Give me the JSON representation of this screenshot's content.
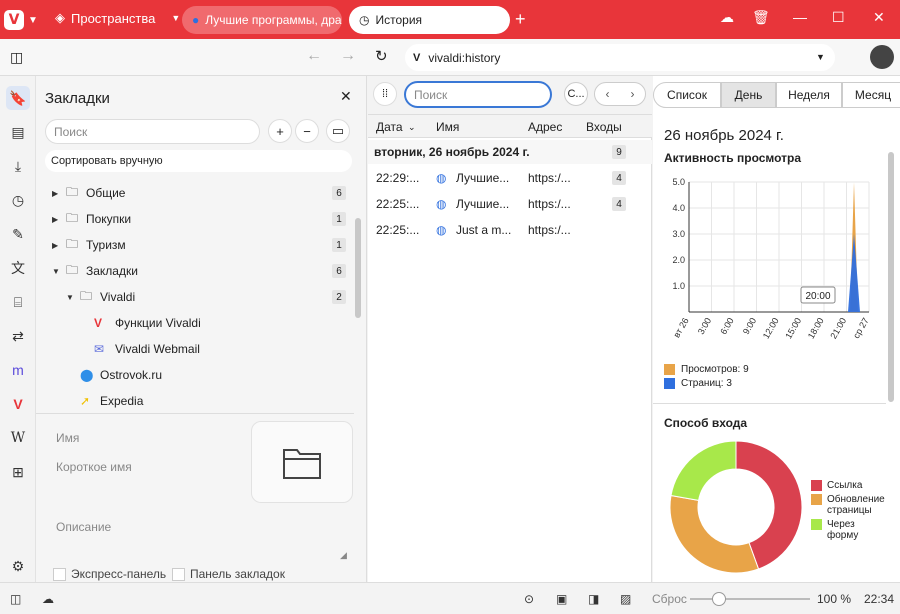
{
  "titlebar": {
    "spaces_label": "Пространства",
    "tabs": [
      {
        "title": "Лучшие программы, драй"
      },
      {
        "title": "История"
      }
    ]
  },
  "addressbar": {
    "url": "vivaldi:history"
  },
  "bookmarks": {
    "title": "Закладки",
    "search_placeholder": "Поиск",
    "sort_label": "Сортировать вручную",
    "items": [
      {
        "label": "Общие",
        "count": "6"
      },
      {
        "label": "Покупки",
        "count": "1"
      },
      {
        "label": "Туризм",
        "count": "1"
      },
      {
        "label": "Закладки",
        "count": "6"
      },
      {
        "label": "Vivaldi",
        "count": "2"
      },
      {
        "label": "Функции Vivaldi"
      },
      {
        "label": "Vivaldi Webmail"
      },
      {
        "label": "Ostrovok.ru"
      },
      {
        "label": "Expedia"
      }
    ],
    "form": {
      "name_label": "Имя",
      "nickname_label": "Короткое имя",
      "description_label": "Описание",
      "speed_dial_label": "Экспресс-панель",
      "bookmark_bar_label": "Панель закладок"
    }
  },
  "history": {
    "search_placeholder": "Поиск",
    "columns": {
      "date": "Дата",
      "name": "Имя",
      "address": "Адрес",
      "visits": "Входы"
    },
    "day_label": "вторник, 26 ноябрь 2024 г.",
    "day_count": "9",
    "rows": [
      {
        "time": "22:29:...",
        "name": "Лучшие...",
        "address": "https:/...",
        "visits": "4"
      },
      {
        "time": "22:25:...",
        "name": "Лучшие...",
        "address": "https:/...",
        "visits": "4"
      },
      {
        "time": "22:25:...",
        "name": "Just a m...",
        "address": "https:/...",
        "visits": ""
      }
    ],
    "c_button": "С..."
  },
  "stats": {
    "view_tabs": [
      "Список",
      "День",
      "Неделя",
      "Месяц"
    ],
    "active_tab": "День",
    "date_title": "26 ноябрь 2024 г.",
    "activity_title": "Активность просмотра",
    "tooltip": "20:00",
    "legend": [
      {
        "label": "Просмотров: 9",
        "color": "#e8a448"
      },
      {
        "label": "Страниц: 3",
        "color": "#2f6fde"
      }
    ],
    "entry_title": "Способ входа",
    "entry_legend": [
      {
        "label": "Ссылка",
        "color": "#d9414f"
      },
      {
        "label": "Обновление страницы",
        "color": "#e8a448"
      },
      {
        "label": "Через форму",
        "color": "#a8e84a"
      }
    ]
  },
  "chart_data": [
    {
      "type": "area",
      "title": "Активность просмотра",
      "x": [
        "вт 26",
        "3:00",
        "6:00",
        "9:00",
        "12:00",
        "15:00",
        "18:00",
        "21:00",
        "ср 27"
      ],
      "yticks": [
        1.0,
        2.0,
        3.0,
        4.0,
        5.0
      ],
      "ylim": [
        0,
        5
      ],
      "series": [
        {
          "name": "Просмотров: 9",
          "spike_time": "22:00",
          "value": 5.0
        },
        {
          "name": "Страниц: 3",
          "spike_time": "22:00",
          "value": 3.0
        }
      ]
    },
    {
      "type": "pie",
      "title": "Способ входа",
      "labels": [
        "Ссылка",
        "Обновление страницы",
        "Через форму"
      ],
      "values": [
        4,
        3,
        2
      ]
    }
  ],
  "statusbar": {
    "reset_label": "Сброс",
    "zoom": "100 %",
    "clock": "22:34"
  }
}
